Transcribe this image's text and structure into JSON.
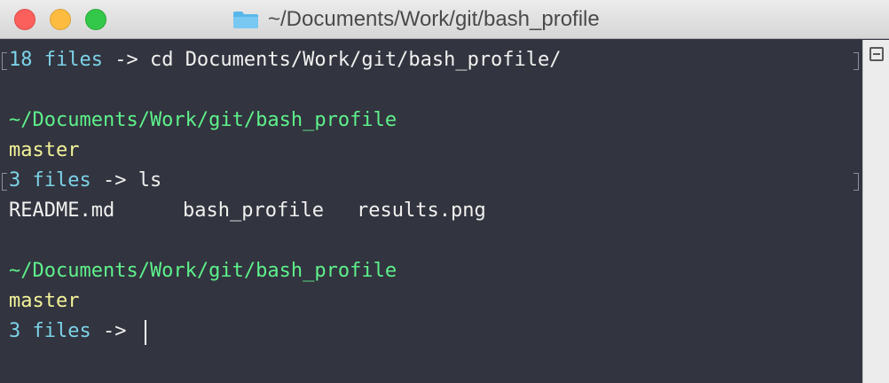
{
  "window": {
    "title": "~/Documents/Work/git/bash_profile",
    "icon": "folder-icon"
  },
  "terminal": {
    "lines": [
      {
        "count": "18 files",
        "arrow": " -> ",
        "command": "cd Documents/Work/git/bash_profile/"
      },
      {
        "path": "~/Documents/Work/git/bash_profile"
      },
      {
        "branch": "master"
      },
      {
        "count": "3 files",
        "arrow": " -> ",
        "command": "ls"
      },
      {
        "files": [
          "README.md",
          "bash_profile",
          "results.png"
        ]
      },
      {
        "path": "~/Documents/Work/git/bash_profile"
      },
      {
        "branch": "master"
      },
      {
        "count": "3 files",
        "arrow": " -> ",
        "command": ""
      }
    ]
  },
  "colors": {
    "background": "#32343f",
    "prompt_count": "#7cd3e8",
    "path": "#5ef18b",
    "branch": "#f4f49a",
    "text": "#f1f1f0"
  },
  "scrollbar": {
    "icon": "split-pane-icon"
  }
}
